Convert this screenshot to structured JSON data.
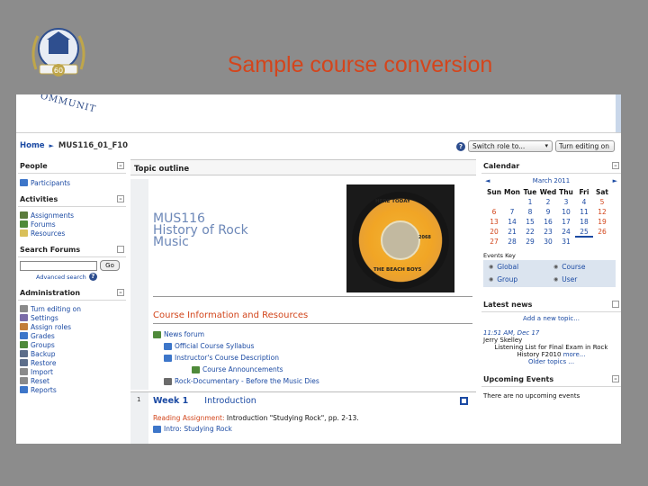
{
  "slide": {
    "title": "Sample course conversion"
  },
  "seal": {
    "text": "60"
  },
  "banner": {
    "community_text": "OMMUNIT"
  },
  "nav": {
    "home": "Home",
    "arrow": "►",
    "course": "MUS116_01_F10",
    "role_select": "Switch role to...",
    "edit_button": "Turn editing on"
  },
  "left": {
    "people": {
      "title": "People",
      "items": [
        "Participants"
      ]
    },
    "activities": {
      "title": "Activities",
      "items": [
        "Assignments",
        "Forums",
        "Resources"
      ]
    },
    "search": {
      "title": "Search Forums",
      "go": "Go",
      "advanced": "Advanced search"
    },
    "admin": {
      "title": "Administration",
      "items": [
        "Turn editing on",
        "Settings",
        "Assign roles",
        "Grades",
        "Groups",
        "Backup",
        "Restore",
        "Import",
        "Reset",
        "Reports"
      ]
    }
  },
  "center": {
    "topic_title": "Topic outline",
    "course_title_lines": [
      "MUS116",
      "History of Rock",
      "Music"
    ],
    "record": {
      "line1": "HERE TODAY",
      "line2": "THE BEACH BOYS",
      "line3": "2068"
    },
    "cir_heading": "Course Information and Resources",
    "items": [
      "News forum",
      "Official Course Syllabus",
      "Instructor's Course Description",
      "Course Announcements",
      "Rock-Documentary - Before the Music Dies"
    ],
    "week": {
      "num": "1",
      "label": "Week 1",
      "title": "Introduction",
      "reading_label": "Reading Assignment:",
      "reading_text": " Introduction \"Studying Rock\", pp. 2-13.",
      "intro_link": "Intro: Studying Rock"
    }
  },
  "right": {
    "calendar": {
      "title": "Calendar",
      "month": "March 2011",
      "prev": "◄",
      "next": "►",
      "days": [
        "Sun",
        "Mon",
        "Tue",
        "Wed",
        "Thu",
        "Fri",
        "Sat"
      ],
      "weeks": [
        [
          "",
          "",
          "1",
          "2",
          "3",
          "4",
          "5"
        ],
        [
          "6",
          "7",
          "8",
          "9",
          "10",
          "11",
          "12"
        ],
        [
          "13",
          "14",
          "15",
          "16",
          "17",
          "18",
          "19"
        ],
        [
          "20",
          "21",
          "22",
          "23",
          "24",
          "25",
          "26"
        ],
        [
          "27",
          "28",
          "29",
          "30",
          "31",
          "",
          ""
        ]
      ],
      "today": "25"
    },
    "events_key": {
      "title": "Events Key",
      "global": "Global",
      "course": "Course",
      "group": "Group",
      "user": "User"
    },
    "latest": {
      "title": "Latest news",
      "add": "Add a new topic...",
      "time": "11:51 AM, Dec 17",
      "who": "Jerry Skelley",
      "text": "Listening List for Final Exam in Rock History F2010",
      "more": "more...",
      "older": "Older topics ..."
    },
    "upcoming": {
      "title": "Upcoming Events",
      "text": "There are no upcoming events"
    }
  },
  "colors": {
    "accent": "#d2451b",
    "link": "#1b4aa3",
    "title": "#d4451c"
  },
  "icons": {
    "people": "participants-icon",
    "assignments": "assignment-icon",
    "forums": "forum-icon",
    "resources": "resource-icon"
  }
}
